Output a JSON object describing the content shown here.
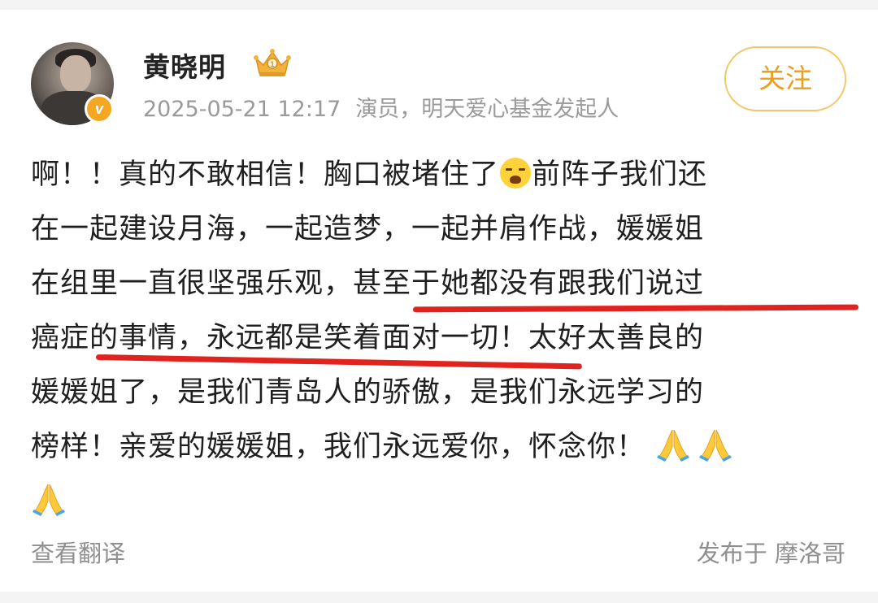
{
  "header": {
    "username": "黄晓明",
    "timestamp": "2025-05-21 12:17",
    "bio": "演员，明天爱心基金发起人",
    "verified_badge": "v",
    "follow_label": "关注",
    "crown_icon": "crown-icon",
    "accent_color": "#e8a020"
  },
  "post": {
    "lines": [
      "啊！！真的不敢相信！胸口被堵住了",
      "前阵子我们还",
      "在一起建设月海，一起造梦，一起并肩作战，媛媛姐",
      "在组里一直很坚强乐观，甚至于她都没有跟我们说过",
      "癌症的事情，永远都是笑着面对一切！太好太善良的",
      "媛媛姐了，是我们青岛人的骄傲，是我们永远学习的",
      "榜样！亲爱的媛媛姐，我们永远爱你，怀念你！"
    ],
    "emojis": [
      "crying-face-emoji",
      "folded-hands-emoji"
    ],
    "underline_color": "#e0231e"
  },
  "footer": {
    "translate_label": "查看翻译",
    "location": "发布于 摩洛哥"
  }
}
